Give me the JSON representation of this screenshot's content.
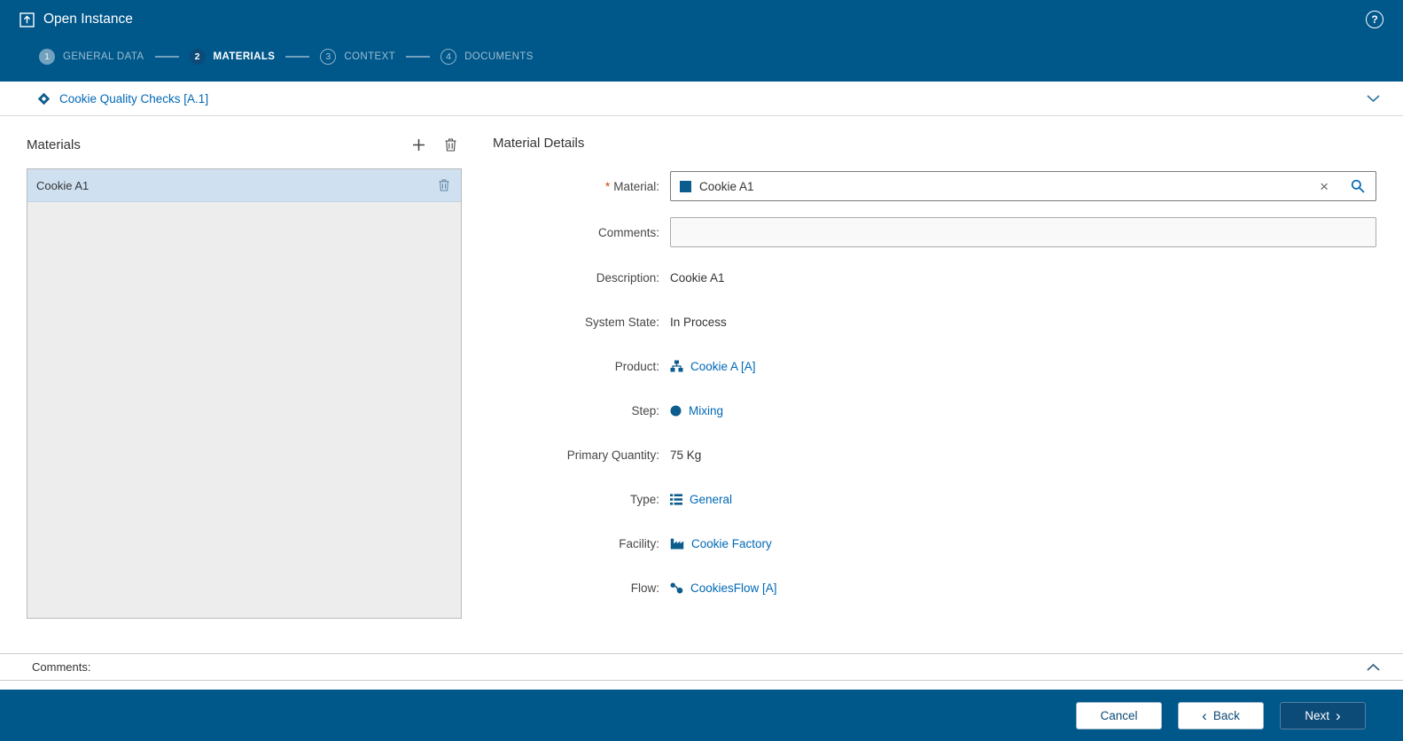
{
  "colors": {
    "header_blue": "#00578a",
    "active_dark_blue": "#0c4a77",
    "link_blue": "#0068b5",
    "selected_item_bg": "#cfe1f1",
    "required_marker": "#cf4500",
    "panel_bg": "#ededed"
  },
  "header": {
    "title": "Open Instance",
    "help_glyph": "?"
  },
  "wizard": {
    "steps": [
      {
        "number": "1",
        "label": "GENERAL DATA",
        "state": "completed"
      },
      {
        "number": "2",
        "label": "MATERIALS",
        "state": "active"
      },
      {
        "number": "3",
        "label": "CONTEXT",
        "state": "upcoming"
      },
      {
        "number": "4",
        "label": "DOCUMENTS",
        "state": "upcoming"
      }
    ]
  },
  "instance_bar": {
    "link": "Cookie Quality Checks [A.1]"
  },
  "materials_panel": {
    "title": "Materials",
    "items": [
      {
        "name": "Cookie A1",
        "selected": true
      }
    ]
  },
  "details": {
    "title": "Material Details",
    "material": {
      "required": "*",
      "label": "Material:",
      "value": "Cookie A1"
    },
    "comments": {
      "label": "Comments:",
      "value": ""
    },
    "rows": [
      {
        "label": "Description:",
        "value": "Cookie A1"
      },
      {
        "label": "System State:",
        "value": "In Process"
      },
      {
        "label": "Product:",
        "value": "Cookie A [A]"
      },
      {
        "label": "Step:",
        "value": "Mixing"
      },
      {
        "label": "Primary Quantity:",
        "value": "75 Kg"
      },
      {
        "label": "Type:",
        "value": "General"
      },
      {
        "label": "Facility:",
        "value": "Cookie Factory"
      },
      {
        "label": "Flow:",
        "value": "CookiesFlow [A]"
      }
    ]
  },
  "comments_bar": {
    "label": "Comments:"
  },
  "footer": {
    "cancel_label": "Cancel",
    "back_label": "Back",
    "next_label": "Next",
    "back_chevron": "‹",
    "next_chevron": "›"
  },
  "icons": {
    "clear": "×"
  }
}
